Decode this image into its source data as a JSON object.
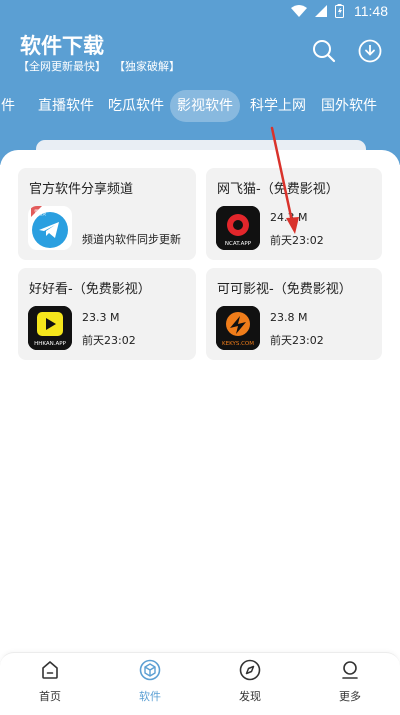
{
  "status": {
    "time": "11:48"
  },
  "header": {
    "title": "软件下载",
    "subtitle_1": "【全网更新最快】",
    "subtitle_2": "【独家破解】"
  },
  "tabs": [
    {
      "label": "件"
    },
    {
      "label": "直播软件"
    },
    {
      "label": "吃瓜软件"
    },
    {
      "label": "影视软件",
      "active": true
    },
    {
      "label": "科学上网"
    },
    {
      "label": "国外软件"
    }
  ],
  "cards": [
    {
      "title": "官方软件分享频道",
      "desc": "频道内软件同步更新",
      "icon": "telegram-icon",
      "badge": "置顶"
    },
    {
      "title": "网飞猫-（免费影视）",
      "size": "24.3 M",
      "date": "前天23:02",
      "icon": "ncat-app-icon",
      "icon_text": "NCAT.APP"
    },
    {
      "title": "好好看-（免费影视）",
      "size": "23.3 M",
      "date": "前天23:02",
      "icon": "hhkan-app-icon",
      "icon_text": "HHKAN.APP"
    },
    {
      "title": "可可影视-（免费影视）",
      "size": "23.8 M",
      "date": "前天23:02",
      "icon": "keke-app-icon",
      "icon_text": "KEKYS.COM"
    }
  ],
  "nav": [
    {
      "label": "首页",
      "icon": "home-icon"
    },
    {
      "label": "软件",
      "icon": "cube-icon",
      "active": true
    },
    {
      "label": "发现",
      "icon": "compass-icon"
    },
    {
      "label": "更多",
      "icon": "user-icon"
    }
  ],
  "colors": {
    "primary": "#5b9fd3",
    "card_bg": "#f2f2f2",
    "annotation_arrow": "#d9322b"
  }
}
